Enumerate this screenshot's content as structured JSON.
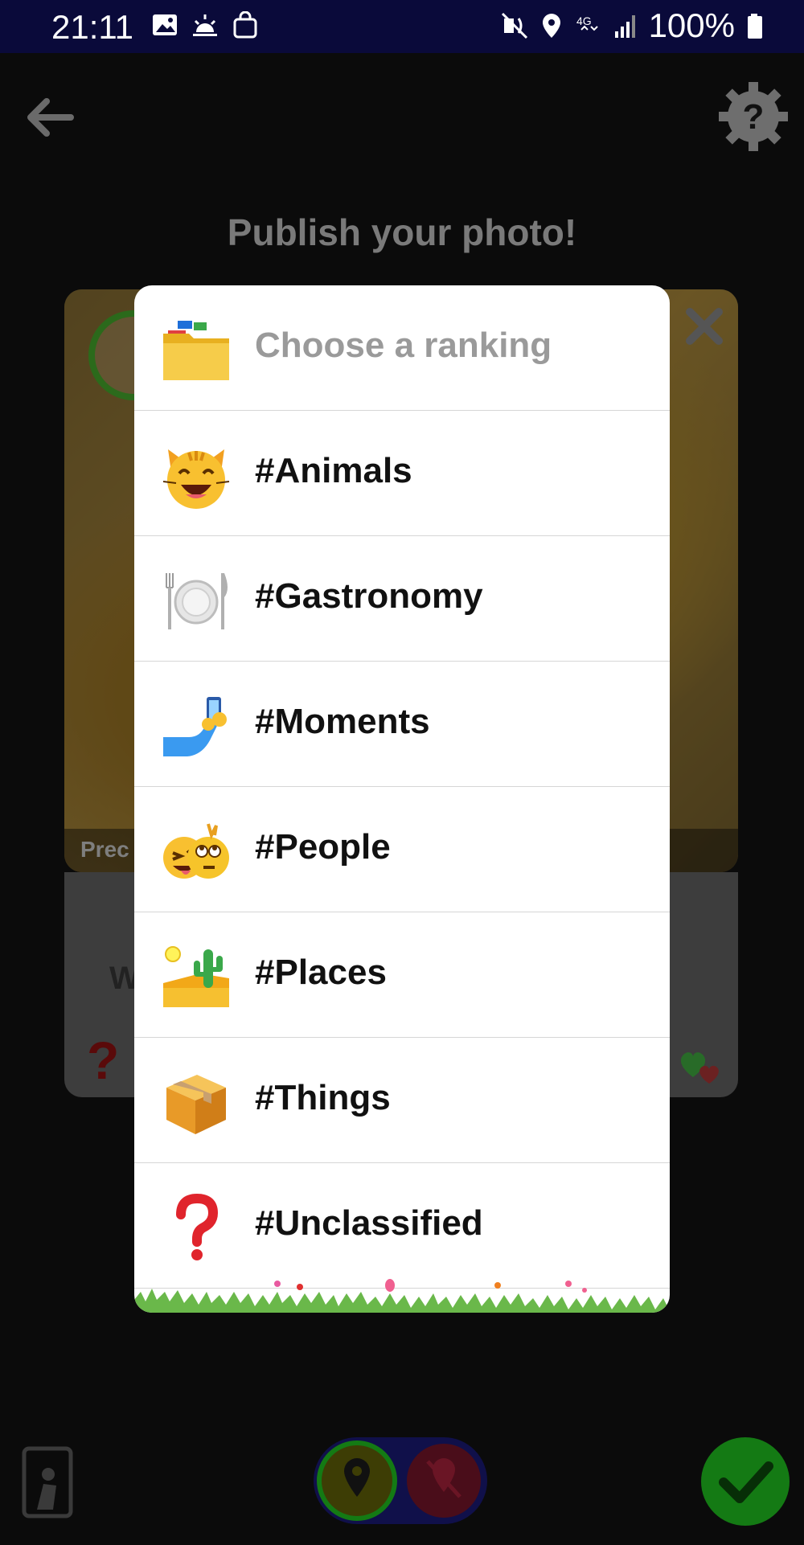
{
  "status_bar": {
    "time": "21:11",
    "battery": "100%",
    "network": "4G"
  },
  "page": {
    "title": "Publish your photo!",
    "precision_label": "Prec",
    "description_label": "W",
    "unknown_mark": "?"
  },
  "ranking_dialog": {
    "header": "Choose a ranking",
    "items": [
      {
        "label": "#Animals",
        "icon": "cat-face-icon"
      },
      {
        "label": "#Gastronomy",
        "icon": "plate-cutlery-icon"
      },
      {
        "label": "#Moments",
        "icon": "selfie-icon"
      },
      {
        "label": "#People",
        "icon": "faces-icon"
      },
      {
        "label": "#Places",
        "icon": "desert-icon"
      },
      {
        "label": "#Things",
        "icon": "package-icon"
      },
      {
        "label": "#Unclassified",
        "icon": "question-mark-icon"
      }
    ]
  },
  "colors": {
    "status_bar_bg": "#0a0a3a",
    "accent_green": "#147a14",
    "unclassified_red": "#e0242c",
    "header_gray": "#9a9a9a"
  }
}
